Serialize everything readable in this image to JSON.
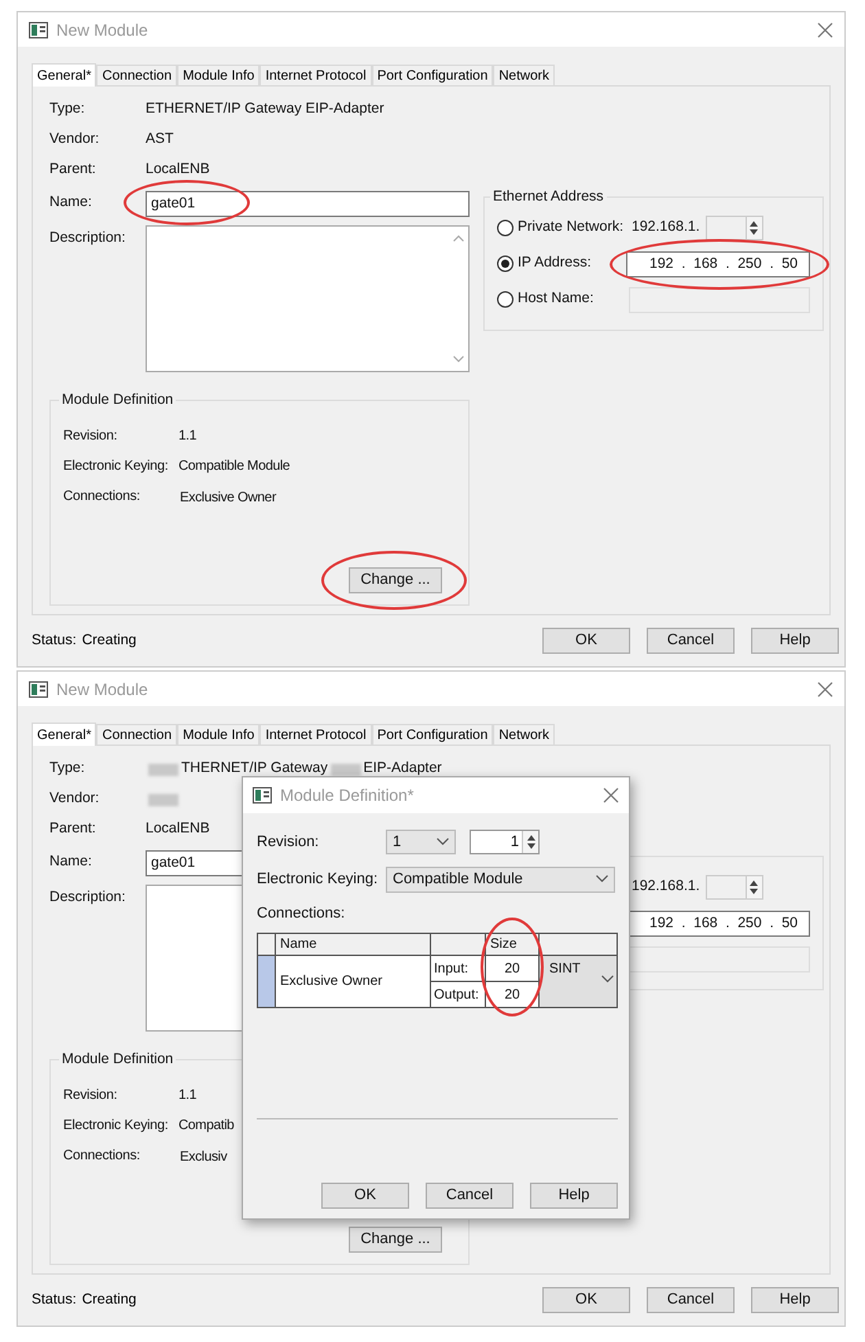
{
  "dialogs": [
    {
      "title": "New Module",
      "tabs": [
        {
          "label": "General*",
          "selected": true
        },
        {
          "label": "Connection",
          "selected": false
        },
        {
          "label": "Module Info",
          "selected": false
        },
        {
          "label": "Internet Protocol",
          "selected": false
        },
        {
          "label": "Port Configuration",
          "selected": false
        },
        {
          "label": "Network",
          "selected": false
        }
      ],
      "info": [
        {
          "label": "Type:",
          "segments": [
            {
              "kind": "text",
              "text": "ETHERNET/IP Gateway EIP-Adapter"
            }
          ]
        },
        {
          "label": "Vendor:",
          "segments": [
            {
              "kind": "text",
              "text": "AST"
            }
          ]
        },
        {
          "label": "Parent:",
          "segments": [
            {
              "kind": "text",
              "text": "LocalENB"
            }
          ]
        }
      ],
      "name": {
        "label": "Name:",
        "value": "gate01",
        "highlighted": true
      },
      "description": {
        "label": "Description:"
      },
      "module_definition": {
        "legend": "Module Definition",
        "rows": [
          {
            "label": "Revision:",
            "value": "1.1"
          },
          {
            "label": "Electronic Keying:",
            "value": "Compatible Module"
          },
          {
            "label": "Connections:",
            "value": "Exclusive Owner"
          }
        ],
        "change_button": {
          "label": "Change ...",
          "highlighted": true
        }
      },
      "ethernet": {
        "legend": "Ethernet Address",
        "options": [
          {
            "kind": "private",
            "label": "Private Network:",
            "selected": false,
            "prefix": "192.168.1."
          },
          {
            "kind": "ip",
            "label": "IP Address:",
            "selected": true,
            "value": "192  .  168  .  250  .  50",
            "highlighted": true
          },
          {
            "kind": "host",
            "label": "Host Name:",
            "selected": false
          }
        ]
      },
      "status": {
        "label": "Status:",
        "value": "Creating"
      },
      "buttons": [
        "OK",
        "Cancel",
        "Help"
      ]
    },
    {
      "title": "New Module",
      "tabs": [
        {
          "label": "General*",
          "selected": true
        },
        {
          "label": "Connection",
          "selected": false
        },
        {
          "label": "Module Info",
          "selected": false
        },
        {
          "label": "Internet Protocol",
          "selected": false
        },
        {
          "label": "Port Configuration",
          "selected": false
        },
        {
          "label": "Network",
          "selected": false
        }
      ],
      "info": [
        {
          "label": "Type:",
          "segments": [
            {
              "kind": "redacted"
            },
            {
              "kind": "text",
              "text": "THERNET/IP Gateway"
            },
            {
              "kind": "redacted"
            },
            {
              "kind": "text",
              "text": "EIP-Adapter"
            }
          ]
        },
        {
          "label": "Vendor:",
          "segments": [
            {
              "kind": "redacted"
            }
          ]
        },
        {
          "label": "Parent:",
          "segments": [
            {
              "kind": "text",
              "text": "LocalENB"
            }
          ]
        }
      ],
      "name": {
        "label": "Name:",
        "value": "gate01"
      },
      "description": {
        "label": "Description:"
      },
      "module_definition": {
        "legend": "Module Definition",
        "rows": [
          {
            "label": "Revision:",
            "value": "1.1"
          },
          {
            "label": "Electronic Keying:",
            "value": "Compatib"
          },
          {
            "label": "Connections:",
            "value": "Exclusiv"
          }
        ],
        "change_button": {
          "label": "Change ..."
        }
      },
      "ethernet": {
        "options": [
          {
            "kind": "private",
            "prefix": "192.168.1."
          },
          {
            "kind": "ip",
            "value": "192  .  168  .  250  .  50"
          },
          {
            "kind": "host"
          }
        ]
      },
      "status": {
        "label": "Status:",
        "value": "Creating"
      },
      "buttons": [
        "OK",
        "Cancel",
        "Help"
      ],
      "popup": {
        "title": "Module Definition*",
        "revision": {
          "label": "Revision:",
          "major": "1",
          "minor": "1"
        },
        "keying": {
          "label": "Electronic Keying:",
          "value": "Compatible Module"
        },
        "connections_label": "Connections:",
        "table": {
          "columns": [
            "Name",
            "Size"
          ],
          "size_highlighted": true,
          "rows": [
            {
              "name": "Exclusive Owner",
              "sizes": [
                {
                  "label": "Input:",
                  "value": "20"
                },
                {
                  "label": "Output:",
                  "value": "20"
                }
              ],
              "type": "SINT"
            }
          ]
        },
        "buttons": [
          "OK",
          "Cancel",
          "Help"
        ]
      }
    }
  ]
}
